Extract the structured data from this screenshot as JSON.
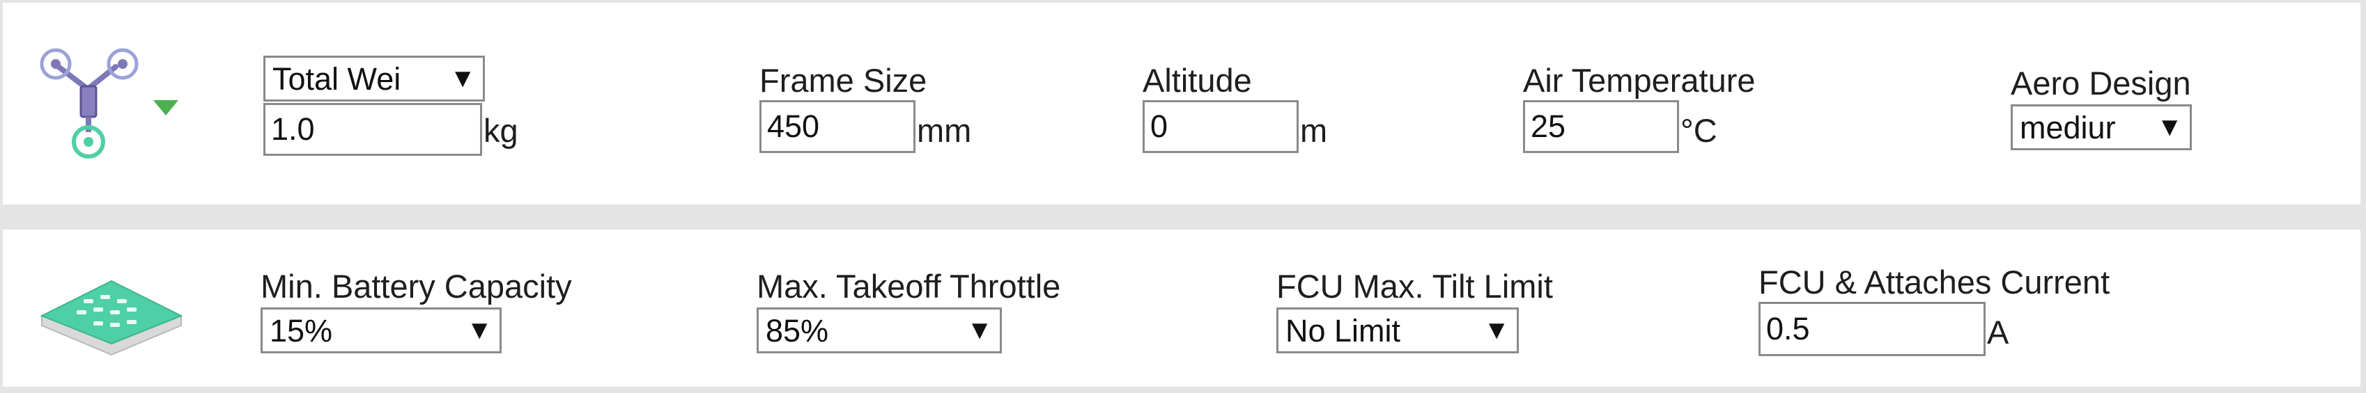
{
  "frame_panel": {
    "icon": "quadcopter-icon",
    "weight_select": "Total Wei",
    "weight_value": "1.0",
    "weight_unit": "kg",
    "frame_size_label": "Frame Size",
    "frame_size_value": "450",
    "frame_size_unit": "mm",
    "altitude_label": "Altitude",
    "altitude_value": "0",
    "altitude_unit": "m",
    "air_temp_label": "Air Temperature",
    "air_temp_value": "25",
    "air_temp_unit": "°C",
    "aero_label": "Aero Design",
    "aero_value": "mediur"
  },
  "battery_panel": {
    "icon": "battery-pack-icon",
    "min_capacity_label": "Min. Battery Capacity",
    "min_capacity_value": "15%",
    "max_throttle_label": "Max. Takeoff Throttle",
    "max_throttle_value": "85%",
    "tilt_label": "FCU Max. Tilt Limit",
    "tilt_value": "No Limit",
    "current_label": "FCU & Attaches Current",
    "current_value": "0.5",
    "current_unit": "A"
  },
  "colors": {
    "accent_green": "#4fcfa6",
    "drone_purple": "#8a7fc0",
    "dropdown_triangle": "#4caf50"
  },
  "dropdown_arrow": "▼"
}
